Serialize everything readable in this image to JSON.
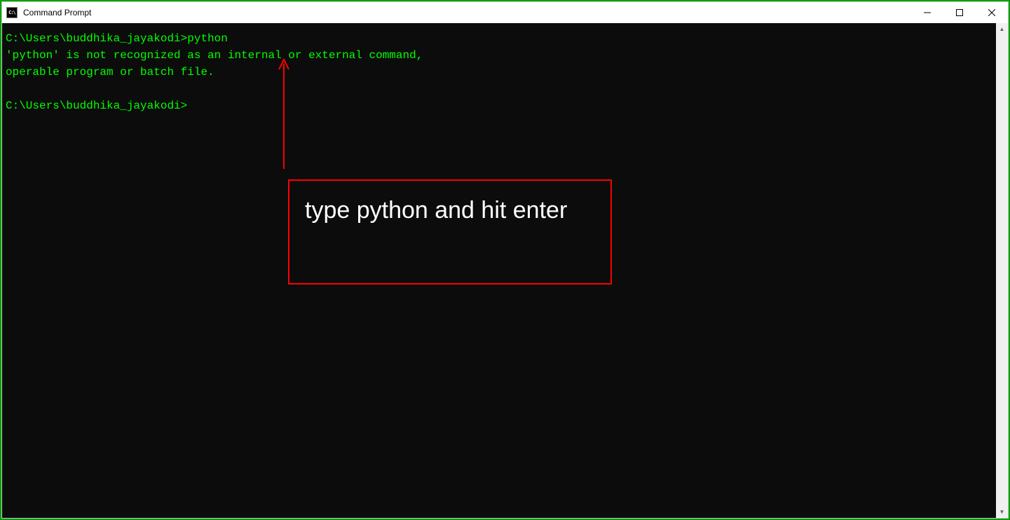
{
  "window": {
    "title": "Command Prompt"
  },
  "terminal": {
    "line1_prompt": "C:\\Users\\buddhika_jayakodi>",
    "line1_cmd": "python",
    "line2": "'python' is not recognized as an internal or external command,",
    "line3": "operable program or batch file.",
    "line4_prompt": "C:\\Users\\buddhika_jayakodi>"
  },
  "annotation": {
    "text": "type python and hit enter",
    "color": "#ff0000"
  }
}
